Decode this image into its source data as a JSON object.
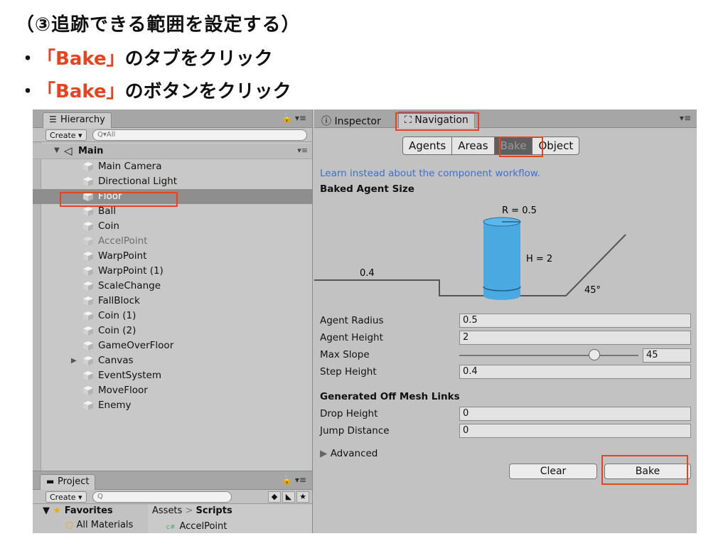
{
  "slide": {
    "title": "（③追跡できる範囲を設定する）",
    "bullets": [
      {
        "dot": "・",
        "highlight": "「Bake」",
        "rest": "のタブをクリック"
      },
      {
        "dot": "・",
        "highlight": "「Bake」",
        "rest": "のボタンをクリック"
      }
    ],
    "accent_color": "#e8431f"
  },
  "hierarchy": {
    "tab_label": "Hierarchy",
    "create_label": "Create",
    "search_placeholder": "Q▾All",
    "scene_name": "Main",
    "items": [
      {
        "label": "Main Camera",
        "state": "normal"
      },
      {
        "label": "Directional Light",
        "state": "normal"
      },
      {
        "label": "Floor",
        "state": "selected"
      },
      {
        "label": "Ball",
        "state": "normal"
      },
      {
        "label": "Coin",
        "state": "normal"
      },
      {
        "label": "AccelPoint",
        "state": "disabled"
      },
      {
        "label": "WarpPoint",
        "state": "normal"
      },
      {
        "label": "WarpPoint (1)",
        "state": "normal"
      },
      {
        "label": "ScaleChange",
        "state": "normal"
      },
      {
        "label": "FallBlock",
        "state": "normal"
      },
      {
        "label": "Coin (1)",
        "state": "normal"
      },
      {
        "label": "Coin (2)",
        "state": "normal"
      },
      {
        "label": "GameOverFloor",
        "state": "normal"
      },
      {
        "label": "Canvas",
        "state": "collapsed"
      },
      {
        "label": "EventSystem",
        "state": "normal"
      },
      {
        "label": "MoveFloor",
        "state": "normal"
      },
      {
        "label": "Enemy",
        "state": "normal"
      }
    ]
  },
  "project": {
    "tab_label": "Project",
    "create_label": "Create",
    "favorites_label": "Favorites",
    "all_materials": "All Materials",
    "breadcrumb_root": "Assets",
    "breadcrumb_sep": ">",
    "breadcrumb_leaf": "Scripts",
    "file_name": "AccelPoint",
    "file_type": "c#"
  },
  "inspector": {
    "inspector_tab": "Inspector",
    "navigation_tab": "Navigation",
    "segments": [
      "Agents",
      "Areas",
      "Bake",
      "Object"
    ],
    "active_segment": "Bake",
    "learn_link": "Learn instead about the component workflow.",
    "baked_agent_size": "Baked Agent Size",
    "diagram": {
      "radius_label": "R = 0.5",
      "height_label": "H = 2",
      "step_label": "0.4",
      "slope_label": "45°"
    },
    "fields": {
      "agent_radius_label": "Agent Radius",
      "agent_radius": "0.5",
      "agent_height_label": "Agent Height",
      "agent_height": "2",
      "max_slope_label": "Max Slope",
      "max_slope": "45",
      "step_height_label": "Step Height",
      "step_height": "0.4"
    },
    "off_mesh": {
      "title": "Generated Off Mesh Links",
      "drop_height_label": "Drop Height",
      "drop_height": "0",
      "jump_distance_label": "Jump Distance",
      "jump_distance": "0"
    },
    "advanced_label": "Advanced",
    "clear_label": "Clear",
    "bake_label": "Bake"
  }
}
